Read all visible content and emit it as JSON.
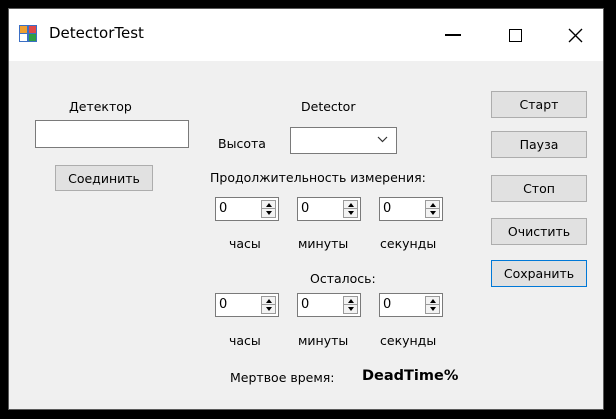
{
  "window": {
    "title": "DetectorTest",
    "icon": "winforms-app-icon",
    "controls": {
      "minimize": "minimize-icon",
      "maximize": "maximize-icon",
      "close": "close-icon"
    }
  },
  "connection": {
    "detector_label": "Детектор",
    "detector_value": "",
    "connect_label": "Соединить"
  },
  "detector": {
    "group_label": "Detector",
    "height_label": "Высота",
    "height_value": ""
  },
  "duration": {
    "label": "Продолжительность измерения:",
    "hours_value": "0",
    "minutes_value": "0",
    "seconds_value": "0",
    "hours_label": "часы",
    "minutes_label": "минуты",
    "seconds_label": "секунды"
  },
  "remaining": {
    "label": "Осталось:",
    "hours_value": "0",
    "minutes_value": "0",
    "seconds_value": "0",
    "hours_label": "часы",
    "minutes_label": "минуты",
    "seconds_label": "секунды"
  },
  "deadtime": {
    "label": "Мертвое время:",
    "value": "DeadTime%"
  },
  "actions": {
    "start": "Старт",
    "pause": "Пауза",
    "stop": "Стоп",
    "clear": "Очистить",
    "save": "Сохранить"
  },
  "colors": {
    "focus_border": "#0078d7",
    "window_bg": "#f0f0f0"
  }
}
